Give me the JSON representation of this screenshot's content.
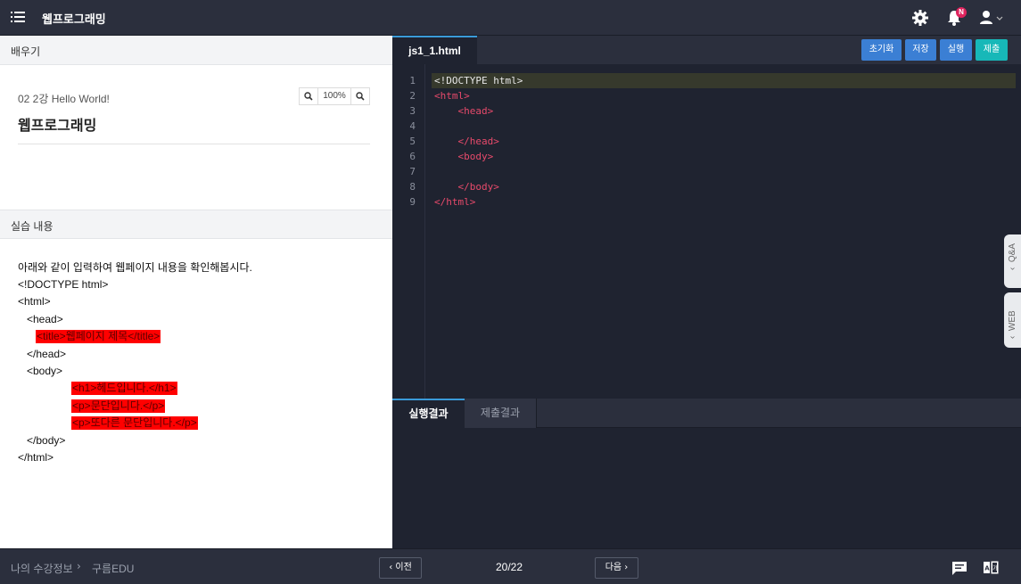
{
  "header": {
    "menu_icon": "hamburger-icon",
    "title": "웹프로그래밍",
    "notification_badge": "N",
    "icons": [
      "gear-icon",
      "bell-icon",
      "user-icon",
      "chevron-down-icon"
    ]
  },
  "learn": {
    "section_label": "배우기",
    "lesson_subtitle": "02 2강 Hello World!",
    "lesson_title": "웹프로그래밍",
    "zoom": "100%"
  },
  "practice": {
    "section_label": "실습 내용",
    "intro": "아래와 같이  입력하여  웹페이지 내용을 확인해봅시다.",
    "lines": [
      {
        "text": "<!DOCTYPE html>",
        "highlight": false
      },
      {
        "text": "<html>",
        "highlight": false
      },
      {
        "text": "<head>",
        "highlight": false
      },
      {
        "text": "<title>웹페이지 제목</title>",
        "highlight": true
      },
      {
        "text": "</head>",
        "highlight": false
      },
      {
        "text": "<body>",
        "highlight": false
      },
      {
        "text": "<h1>헤드입니다.</h1>",
        "highlight": true
      },
      {
        "text": "<p>문단입니다.</p>",
        "highlight": true
      },
      {
        "text": "<p>또다른 문단입니다.</p>",
        "highlight": true
      },
      {
        "text": "</body>",
        "highlight": false
      },
      {
        "text": "</html>",
        "highlight": false
      }
    ]
  },
  "editor": {
    "file_tab": "js1_1.html",
    "buttons": {
      "reset": "초기화",
      "save": "저장",
      "run": "실행",
      "submit": "제출"
    },
    "line_numbers": [
      "1",
      "2",
      "3",
      "4",
      "5",
      "6",
      "7",
      "8",
      "9"
    ],
    "code_lines": [
      "<!DOCTYPE html>",
      "<html>",
      "    <head>",
      "",
      "    </head>",
      "    <body>",
      "",
      "    </body>",
      "</html>"
    ],
    "side_tabs": {
      "qa": "Q&A",
      "web": "WEB"
    }
  },
  "result": {
    "tab_run": "실행결과",
    "tab_submit": "제출결과"
  },
  "footer": {
    "breadcrumb_1": "나의 수강정보",
    "breadcrumb_sep": "›",
    "breadcrumb_2": "구름EDU",
    "prev_label": "‹ 이전",
    "page_counter": "20/22",
    "next_label": "다음 ›",
    "icons": [
      "chat-icon",
      "dictionary-icon"
    ]
  },
  "colors": {
    "highlight": "#ff0000",
    "run_button": "#3b7fd4",
    "submit_button": "#17b8b8",
    "tag_color": "#e84a6b",
    "editor_bg": "#1f2330"
  }
}
